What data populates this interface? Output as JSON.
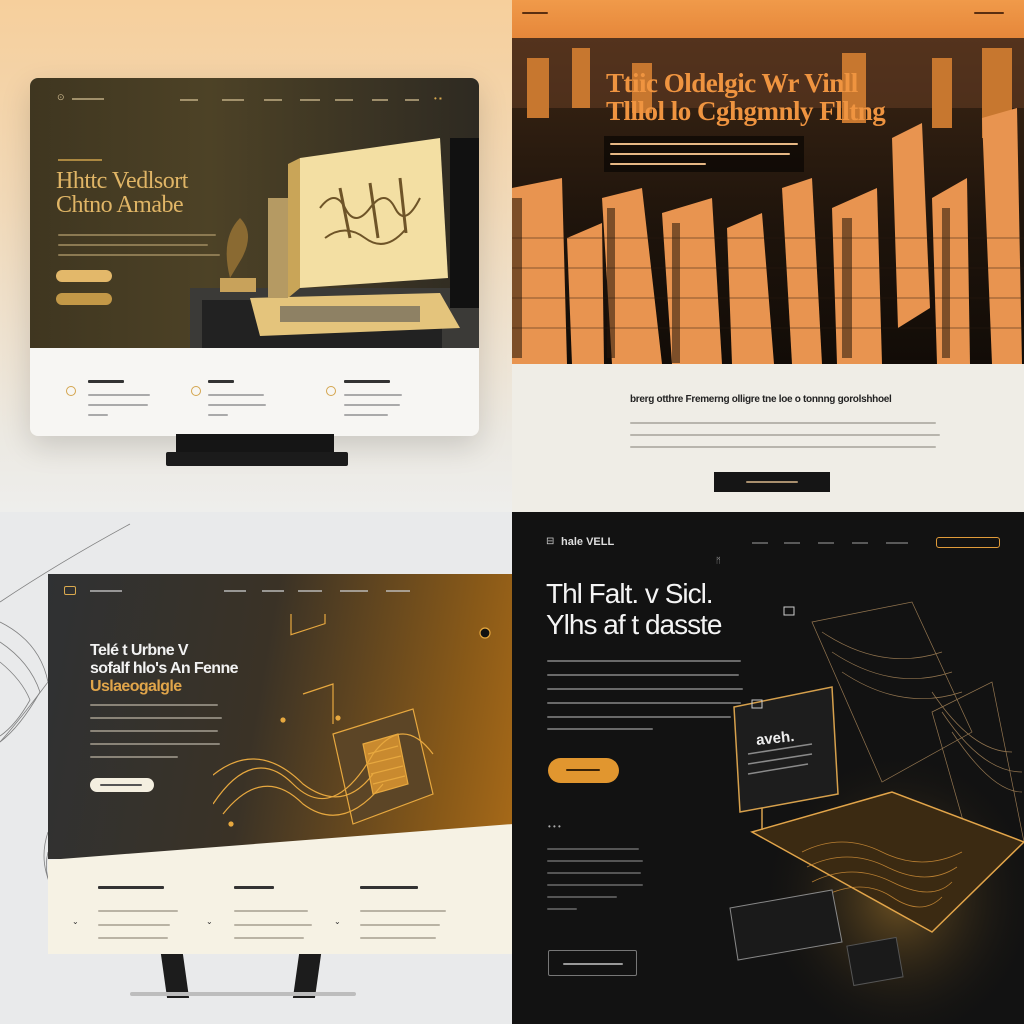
{
  "colors": {
    "accent_orange": "#e6912f",
    "accent_gold": "#d9a94e",
    "dark": "#151515",
    "cream": "#f6f2e4"
  },
  "panel1": {
    "logo": "⊙",
    "heading_line1": "Hhttc Vedlsort",
    "heading_line2": "Chtno Amabe"
  },
  "panel2": {
    "headline_line1": "Ttiic Oldelgic Wr Vinll",
    "headline_line2": "Tlllol lo Cghgmnly Flltng",
    "subhead": "brerg otthre Fremerng olligre tne loe o tonnng gorolshhoel"
  },
  "panel3": {
    "heading_line1": "Telé t Urbne V",
    "heading_line2": "sofalf hlo's An Fenne",
    "heading_line3": "Uslaeogalgle"
  },
  "panel4": {
    "logo_text": "hale VELL",
    "heading_line1": "Thl Falt. v Sicl.",
    "heading_line2": "Ylhs af t dasste",
    "screen_text": "aveh."
  }
}
